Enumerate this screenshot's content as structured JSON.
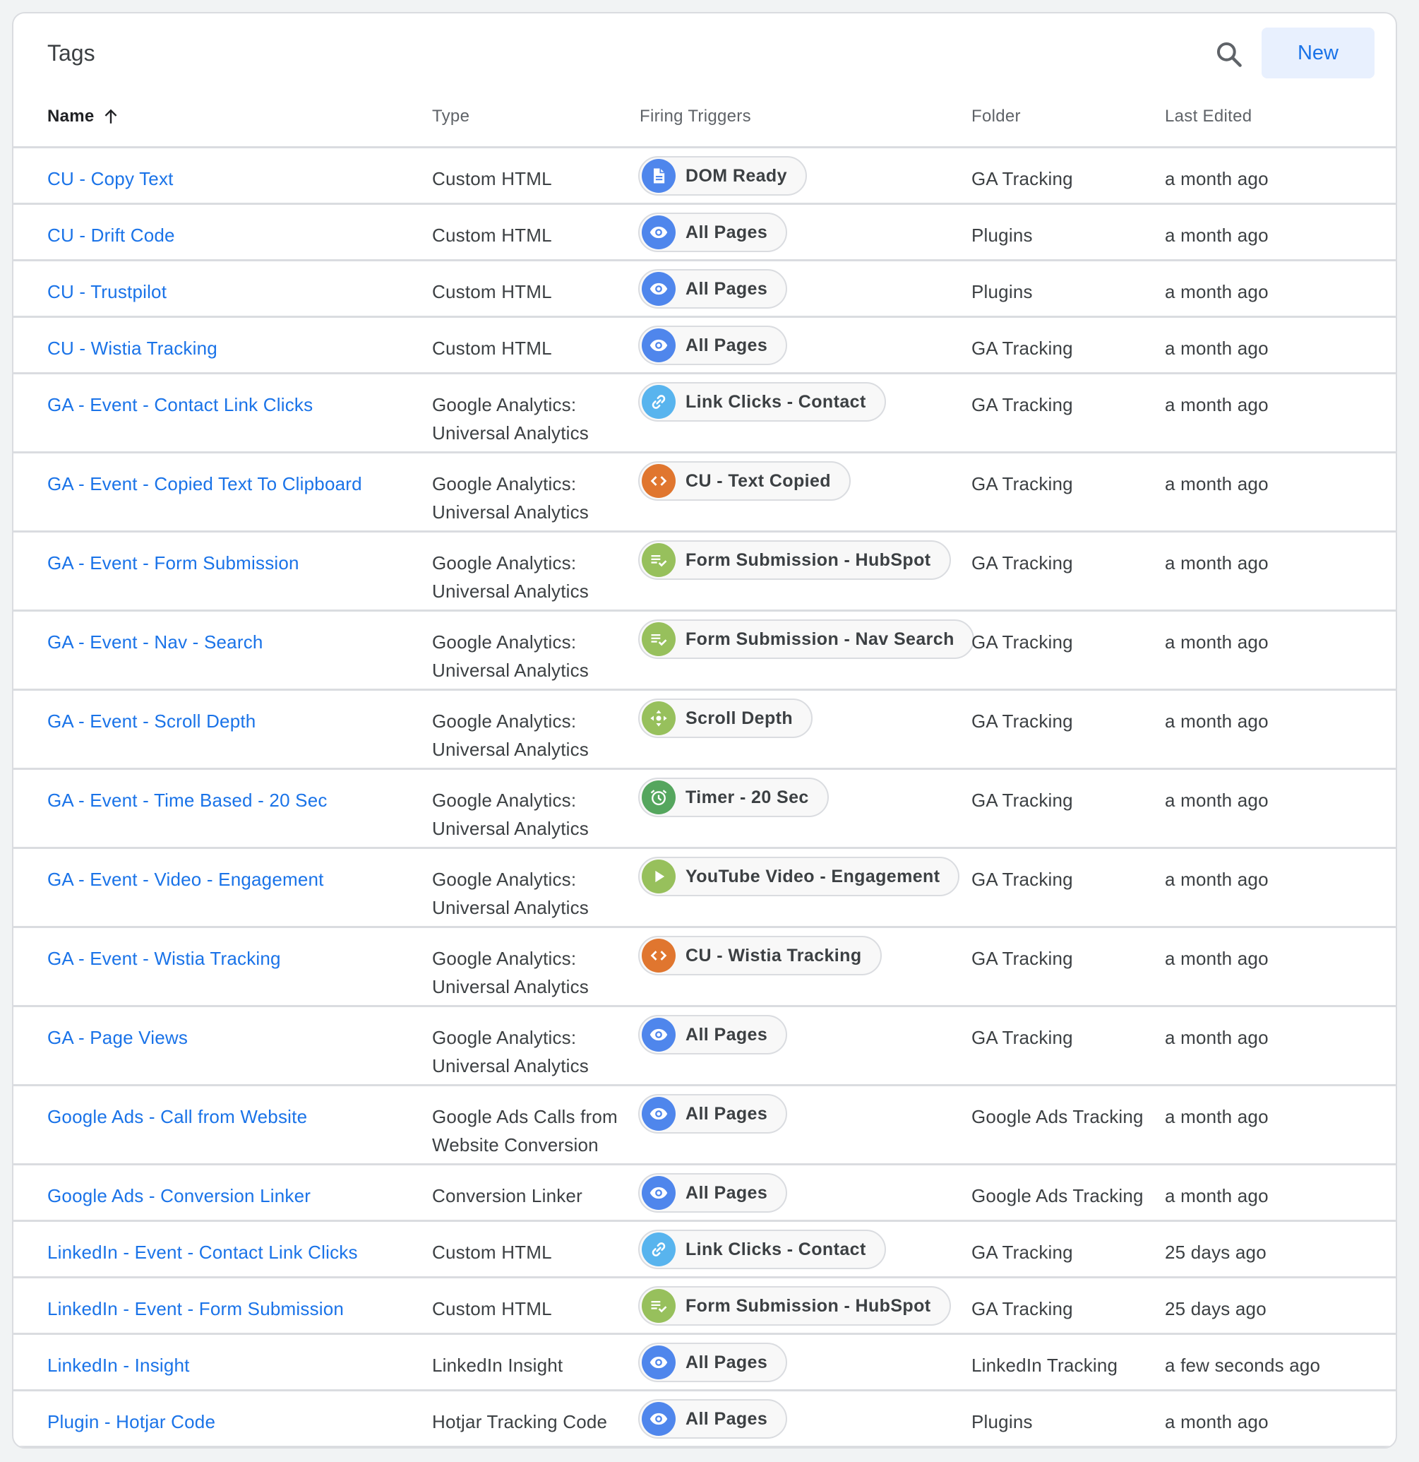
{
  "header": {
    "title": "Tags",
    "search_icon": "search-icon",
    "new_label": "New"
  },
  "columns": {
    "name": "Name",
    "sort_icon": "arrow-up-icon",
    "type": "Type",
    "firing_triggers": "Firing Triggers",
    "folder": "Folder",
    "last_edited": "Last Edited"
  },
  "trigger_icon_colors": {
    "document": "#4f86ec",
    "eye": "#4f86ec",
    "link": "#58b4ee",
    "code": "#e0762f",
    "form": "#97c05c",
    "scroll": "#97c05c",
    "timer": "#55a65e",
    "play": "#97c05c"
  },
  "rows": [
    {
      "name": "CU - Copy Text",
      "type": [
        "Custom HTML"
      ],
      "trigger": {
        "label": "DOM Ready",
        "icon": "document"
      },
      "folder": "GA Tracking",
      "edited": "a month ago"
    },
    {
      "name": "CU - Drift Code",
      "type": [
        "Custom HTML"
      ],
      "trigger": {
        "label": "All Pages",
        "icon": "eye"
      },
      "folder": "Plugins",
      "edited": "a month ago"
    },
    {
      "name": "CU - Trustpilot",
      "type": [
        "Custom HTML"
      ],
      "trigger": {
        "label": "All Pages",
        "icon": "eye"
      },
      "folder": "Plugins",
      "edited": "a month ago"
    },
    {
      "name": "CU - Wistia Tracking",
      "type": [
        "Custom HTML"
      ],
      "trigger": {
        "label": "All Pages",
        "icon": "eye"
      },
      "folder": "GA Tracking",
      "edited": "a month ago"
    },
    {
      "name": "GA - Event - Contact Link Clicks",
      "type": [
        "Google Analytics:",
        "Universal Analytics"
      ],
      "trigger": {
        "label": "Link Clicks - Contact",
        "icon": "link"
      },
      "folder": "GA Tracking",
      "edited": "a month ago"
    },
    {
      "name": "GA - Event - Copied Text To Clipboard",
      "type": [
        "Google Analytics:",
        "Universal Analytics"
      ],
      "trigger": {
        "label": "CU - Text Copied",
        "icon": "code"
      },
      "folder": "GA Tracking",
      "edited": "a month ago"
    },
    {
      "name": "GA - Event - Form Submission",
      "type": [
        "Google Analytics:",
        "Universal Analytics"
      ],
      "trigger": {
        "label": "Form Submission - HubSpot",
        "icon": "form"
      },
      "folder": "GA Tracking",
      "edited": "a month ago"
    },
    {
      "name": "GA - Event - Nav - Search",
      "type": [
        "Google Analytics:",
        "Universal Analytics"
      ],
      "trigger": {
        "label": "Form Submission - Nav Search",
        "icon": "form"
      },
      "folder": "GA Tracking",
      "edited": "a month ago"
    },
    {
      "name": "GA - Event - Scroll Depth",
      "type": [
        "Google Analytics:",
        "Universal Analytics"
      ],
      "trigger": {
        "label": "Scroll Depth",
        "icon": "scroll"
      },
      "folder": "GA Tracking",
      "edited": "a month ago"
    },
    {
      "name": "GA - Event - Time Based - 20 Sec",
      "type": [
        "Google Analytics:",
        "Universal Analytics"
      ],
      "trigger": {
        "label": "Timer - 20 Sec",
        "icon": "timer"
      },
      "folder": "GA Tracking",
      "edited": "a month ago"
    },
    {
      "name": "GA - Event - Video - Engagement",
      "type": [
        "Google Analytics:",
        "Universal Analytics"
      ],
      "trigger": {
        "label": "YouTube Video - Engagement",
        "icon": "play"
      },
      "folder": "GA Tracking",
      "edited": "a month ago"
    },
    {
      "name": "GA - Event - Wistia Tracking",
      "type": [
        "Google Analytics:",
        "Universal Analytics"
      ],
      "trigger": {
        "label": "CU - Wistia Tracking",
        "icon": "code"
      },
      "folder": "GA Tracking",
      "edited": "a month ago"
    },
    {
      "name": "GA - Page Views",
      "type": [
        "Google Analytics:",
        "Universal Analytics"
      ],
      "trigger": {
        "label": "All Pages",
        "icon": "eye"
      },
      "folder": "GA Tracking",
      "edited": "a month ago"
    },
    {
      "name": "Google Ads - Call from Website",
      "type": [
        "Google Ads Calls from",
        "Website Conversion"
      ],
      "trigger": {
        "label": "All Pages",
        "icon": "eye"
      },
      "folder": "Google Ads Tracking",
      "edited": "a month ago"
    },
    {
      "name": "Google Ads - Conversion Linker",
      "type": [
        "Conversion Linker"
      ],
      "trigger": {
        "label": "All Pages",
        "icon": "eye"
      },
      "folder": "Google Ads Tracking",
      "edited": "a month ago"
    },
    {
      "name": "LinkedIn - Event - Contact Link Clicks",
      "type": [
        "Custom HTML"
      ],
      "trigger": {
        "label": "Link Clicks - Contact",
        "icon": "link"
      },
      "folder": "GA Tracking",
      "edited": "25 days ago"
    },
    {
      "name": "LinkedIn - Event - Form Submission",
      "type": [
        "Custom HTML"
      ],
      "trigger": {
        "label": "Form Submission - HubSpot",
        "icon": "form"
      },
      "folder": "GA Tracking",
      "edited": "25 days ago"
    },
    {
      "name": "LinkedIn - Insight",
      "type": [
        "LinkedIn Insight"
      ],
      "trigger": {
        "label": "All Pages",
        "icon": "eye"
      },
      "folder": "LinkedIn Tracking",
      "edited": "a few seconds ago"
    },
    {
      "name": "Plugin - Hotjar Code",
      "type": [
        "Hotjar Tracking Code"
      ],
      "trigger": {
        "label": "All Pages",
        "icon": "eye"
      },
      "folder": "Plugins",
      "edited": "a month ago"
    }
  ]
}
